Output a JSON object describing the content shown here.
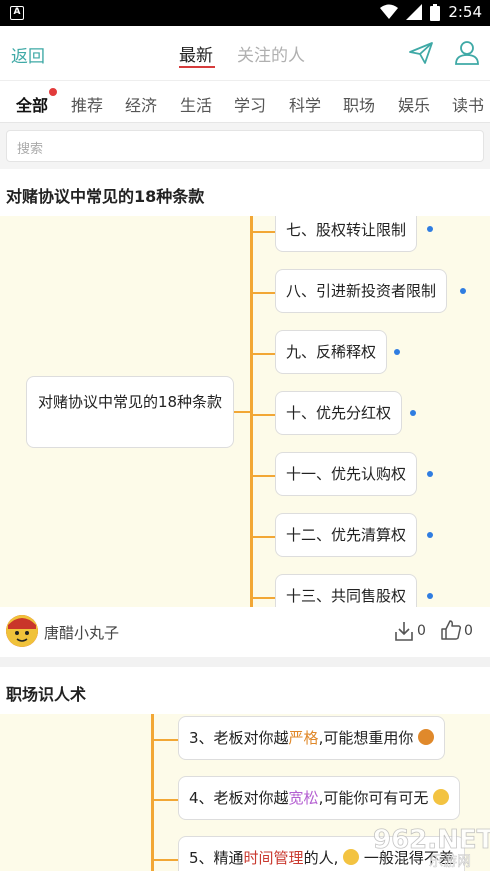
{
  "status_bar": {
    "app_badge": "A",
    "time": "2:54"
  },
  "header": {
    "back_label": "返回",
    "tab_latest": "最新",
    "tab_following": "关注的人"
  },
  "categories": [
    "全部",
    "推荐",
    "经济",
    "生活",
    "学习",
    "科学",
    "职场",
    "娱乐",
    "读书"
  ],
  "search": {
    "placeholder": "搜索"
  },
  "post1": {
    "title": "对赌协议中常见的18种条款",
    "root": "对赌协议中常见的18种条款",
    "nodes": [
      "七、股权转让限制",
      "八、引进新投资者限制",
      "九、反稀释权",
      "十、优先分红权",
      "十一、优先认购权",
      "十二、优先清算权",
      "十三、共同售股权"
    ],
    "author": "唐醋小丸子",
    "downloads": "0",
    "likes": "0"
  },
  "post2": {
    "title": "职场识人术",
    "n3_pre": "3、老板对你越",
    "n3_hl": "严格",
    "n3_post": ",可能想重用你",
    "n4_pre": "4、老板对你越",
    "n4_hl": "宽松",
    "n4_post": ",可能你可有可无",
    "n5_pre": "5、精通",
    "n5_hl": "时间管理",
    "n5_post": "的人,",
    "n5_tail": "一般混得不差"
  },
  "watermark": {
    "text": "962.NET",
    "sub": "乐游网"
  },
  "colors": {
    "accent_teal": "#3fa9a6",
    "underline_red": "#d63c3c",
    "branch_orange": "#f2a735",
    "dot_blue": "#2f7de1"
  }
}
